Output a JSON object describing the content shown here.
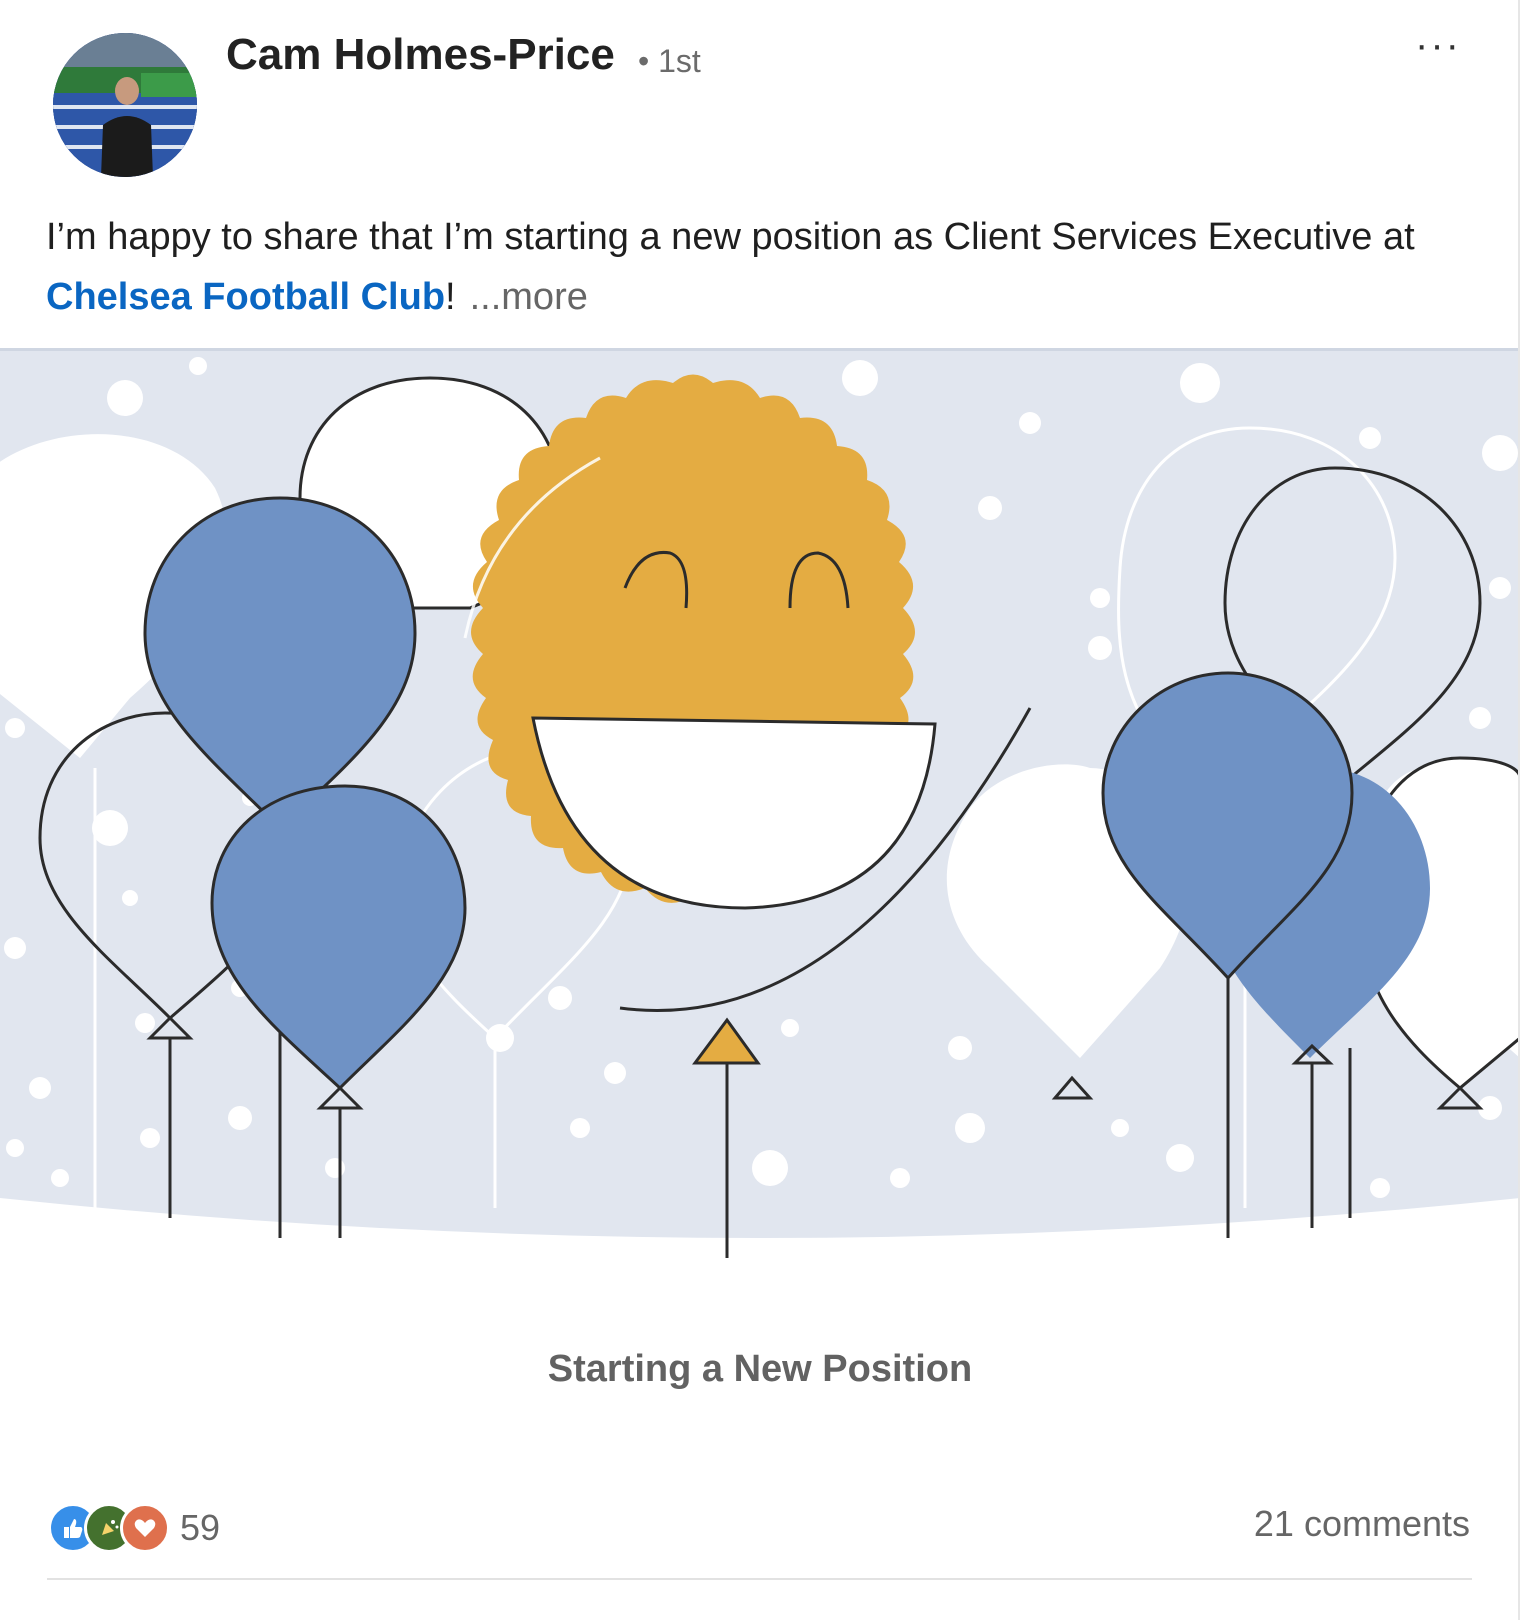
{
  "post": {
    "author": {
      "name": "Cam Holmes-Price",
      "degree": "• 1st"
    },
    "menu_label": "···",
    "text": {
      "lead": "I’m happy to share that I’m starting a new position as Client Services Executive at ",
      "link": "Chelsea Football Club",
      "tail": "!",
      "see_more": "...more"
    },
    "media": {
      "caption": "Starting a New Position"
    },
    "social": {
      "reaction_count": "59",
      "comments": "21 comments",
      "reaction_icons": [
        "like-icon",
        "celebrate-icon",
        "love-icon"
      ]
    }
  },
  "colors": {
    "banner_bg": "#e1e6ef",
    "balloon_blue": "#6f92c5",
    "smiley_gold": "#e4ac42",
    "link_blue": "#0a66c2"
  }
}
